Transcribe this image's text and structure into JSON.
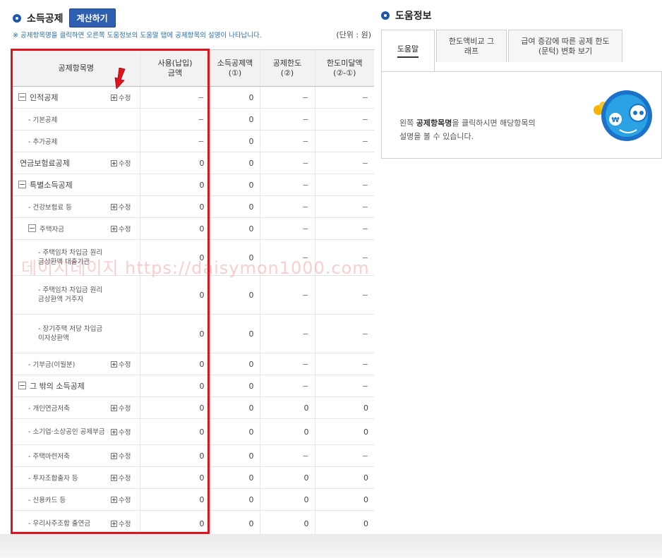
{
  "left": {
    "title": "소득공제",
    "calc_button": "계산하기",
    "notice": "※ 공제항목명을 클릭하면 오른쪽 도움정보의 도움말 탭에 공제항목의 설명이 나타납니다.",
    "unit": "(단위 : 원)"
  },
  "table": {
    "headers": {
      "item": "공제항목명",
      "usage_l1": "사용(납입)",
      "usage_l2": "금액",
      "deduct_l1": "소득공제액",
      "deduct_l2": "(①)",
      "limit_l1": "공제한도",
      "limit_l2": "(②)",
      "under_l1": "한도미달액",
      "under_l2": "(②-①)"
    },
    "edit_label": "수정",
    "rows": [
      {
        "name": "인적공제",
        "usage": "−",
        "deduct": "0",
        "limit": "−",
        "under": "−"
      },
      {
        "name": "- 기본공제",
        "usage": "−",
        "deduct": "0",
        "limit": "−",
        "under": "−"
      },
      {
        "name": "- 추가공제",
        "usage": "−",
        "deduct": "0",
        "limit": "−",
        "under": "−"
      },
      {
        "name": "연금보험료공제",
        "usage": "0",
        "deduct": "0",
        "limit": "−",
        "under": "−"
      },
      {
        "name": "특별소득공제",
        "usage": "0",
        "deduct": "0",
        "limit": "−",
        "under": "−"
      },
      {
        "name": "- 건강보험료 등",
        "usage": "0",
        "deduct": "0",
        "limit": "−",
        "under": "−"
      },
      {
        "name": "주택자금",
        "usage": "0",
        "deduct": "0",
        "limit": "−",
        "under": "−"
      },
      {
        "name": "- 주택임차 차입금 원리금상환액 대출기관",
        "usage": "0",
        "deduct": "0",
        "limit": "−",
        "under": "−"
      },
      {
        "name": "- 주택임차 차입금 원리금상환액 거주자",
        "usage": "0",
        "deduct": "0",
        "limit": "−",
        "under": "−"
      },
      {
        "name": "- 장기주택 저당 차입금 이자상환액",
        "usage": "0",
        "deduct": "0",
        "limit": "−",
        "under": "−"
      },
      {
        "name": "- 기부금(이월분)",
        "usage": "0",
        "deduct": "0",
        "limit": "−",
        "under": "−"
      },
      {
        "name": "그 밖의 소득공제",
        "usage": "0",
        "deduct": "0",
        "limit": "−",
        "under": "−"
      },
      {
        "name": "- 개인연금저축",
        "usage": "0",
        "deduct": "0",
        "limit": "0",
        "under": "0"
      },
      {
        "name": "- 소기업·소상공인 공제부금",
        "usage": "0",
        "deduct": "0",
        "limit": "0",
        "under": "0"
      },
      {
        "name": "- 주택마련저축",
        "usage": "0",
        "deduct": "0",
        "limit": "−",
        "under": "−"
      },
      {
        "name": "- 투자조합출자 등",
        "usage": "0",
        "deduct": "0",
        "limit": "0",
        "under": "0"
      },
      {
        "name": "- 신용카드 등",
        "usage": "0",
        "deduct": "0",
        "limit": "0",
        "under": "0"
      },
      {
        "name": "- 우리사주조합 출연금",
        "usage": "0",
        "deduct": "0",
        "limit": "0",
        "under": "0"
      }
    ]
  },
  "right": {
    "title": "도움정보",
    "tabs": [
      "도움말",
      "한도액비교 그래프",
      "급여 증감에 따른 공제 한도(문턱) 변화 보기"
    ],
    "help_line1_pre": "왼쪽 ",
    "help_line1_bold": "공제항목명",
    "help_line1_post": "을 클릭하시면 해당항목의",
    "help_line2": "설명을 볼 수 있습니다."
  },
  "watermark": "데이지데이지 https://daisymon1000.com",
  "colors": {
    "accent": "#2f5fb0",
    "highlight": "#e0121b"
  }
}
